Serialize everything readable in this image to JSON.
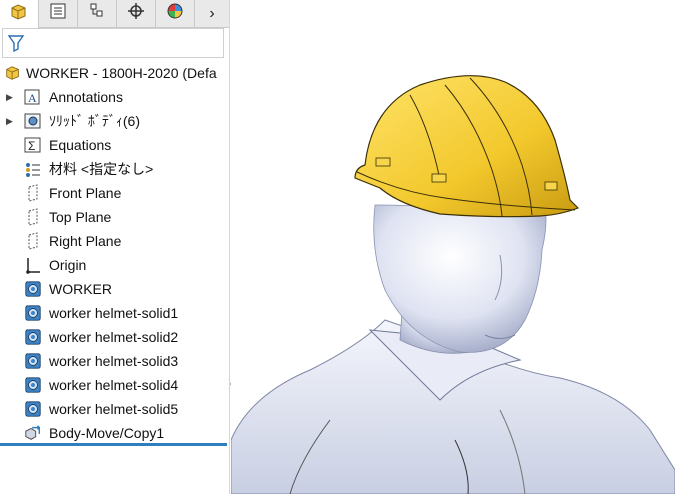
{
  "tabs": [
    {
      "name": "feature-manager-icon"
    },
    {
      "name": "property-manager-icon"
    },
    {
      "name": "configuration-manager-icon"
    },
    {
      "name": "dimxpert-icon"
    },
    {
      "name": "display-manager-icon"
    }
  ],
  "more_label": "›",
  "tree": {
    "root": "WORKER - 1800H-2020  (Defa",
    "items": [
      {
        "label": "Annotations",
        "icon": "annotations-icon",
        "expandable": true
      },
      {
        "label": "ｿﾘｯﾄﾞ ﾎﾞﾃﾞｨ(6)",
        "icon": "solid-bodies-icon",
        "expandable": true
      },
      {
        "label": "Equations",
        "icon": "equations-icon",
        "expandable": false
      },
      {
        "label": "材料 <指定なし>",
        "icon": "material-icon",
        "expandable": false
      },
      {
        "label": "Front Plane",
        "icon": "plane-icon",
        "expandable": false
      },
      {
        "label": "Top Plane",
        "icon": "plane-icon",
        "expandable": false
      },
      {
        "label": "Right Plane",
        "icon": "plane-icon",
        "expandable": false
      },
      {
        "label": "Origin",
        "icon": "origin-icon",
        "expandable": false
      },
      {
        "label": "WORKER",
        "icon": "body-icon",
        "expandable": false
      },
      {
        "label": "worker helmet-solid1",
        "icon": "body-icon",
        "expandable": false
      },
      {
        "label": "worker helmet-solid2",
        "icon": "body-icon",
        "expandable": false
      },
      {
        "label": "worker helmet-solid3",
        "icon": "body-icon",
        "expandable": false
      },
      {
        "label": "worker helmet-solid4",
        "icon": "body-icon",
        "expandable": false
      },
      {
        "label": "worker helmet-solid5",
        "icon": "body-icon",
        "expandable": false
      },
      {
        "label": "Body-Move/Copy1",
        "icon": "move-copy-icon",
        "expandable": false
      }
    ]
  },
  "colors": {
    "helmet": "#f2c82c",
    "body": "#e6e9f5",
    "accent": "#2f7fbf"
  }
}
